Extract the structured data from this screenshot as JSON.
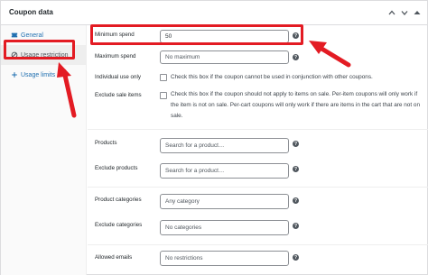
{
  "header": {
    "title": "Coupon data",
    "icons": [
      "chevron-up-icon",
      "chevron-down-icon",
      "triangle-up-icon"
    ]
  },
  "sidebar": {
    "items": [
      {
        "label": "General",
        "icon": "ticket-icon",
        "active": false
      },
      {
        "label": "Usage restriction",
        "icon": "block-icon",
        "active": true
      },
      {
        "label": "Usage limits",
        "icon": "plus-icon",
        "active": false
      }
    ]
  },
  "form": {
    "minimum_spend": {
      "label": "Minimum spend",
      "value": "50"
    },
    "maximum_spend": {
      "label": "Maximum spend",
      "placeholder": "No maximum"
    },
    "individual_use": {
      "label": "Individual use only",
      "description": "Check this box if the coupon cannot be used in conjunction with other coupons."
    },
    "exclude_sale": {
      "label": "Exclude sale items",
      "description": "Check this box if the coupon should not apply to items on sale. Per-item coupons will only work if the item is not on sale. Per-cart coupons will only work if there are items in the cart that are not on sale."
    },
    "products": {
      "label": "Products",
      "placeholder": "Search for a product…"
    },
    "exclude_products": {
      "label": "Exclude products",
      "placeholder": "Search for a product…"
    },
    "product_categories": {
      "label": "Product categories",
      "placeholder": "Any category"
    },
    "exclude_categories": {
      "label": "Exclude categories",
      "placeholder": "No categories"
    },
    "allowed_emails": {
      "label": "Allowed emails",
      "placeholder": "No restrictions"
    }
  },
  "colors": {
    "highlight": "#e31b23",
    "link": "#2271b1"
  }
}
